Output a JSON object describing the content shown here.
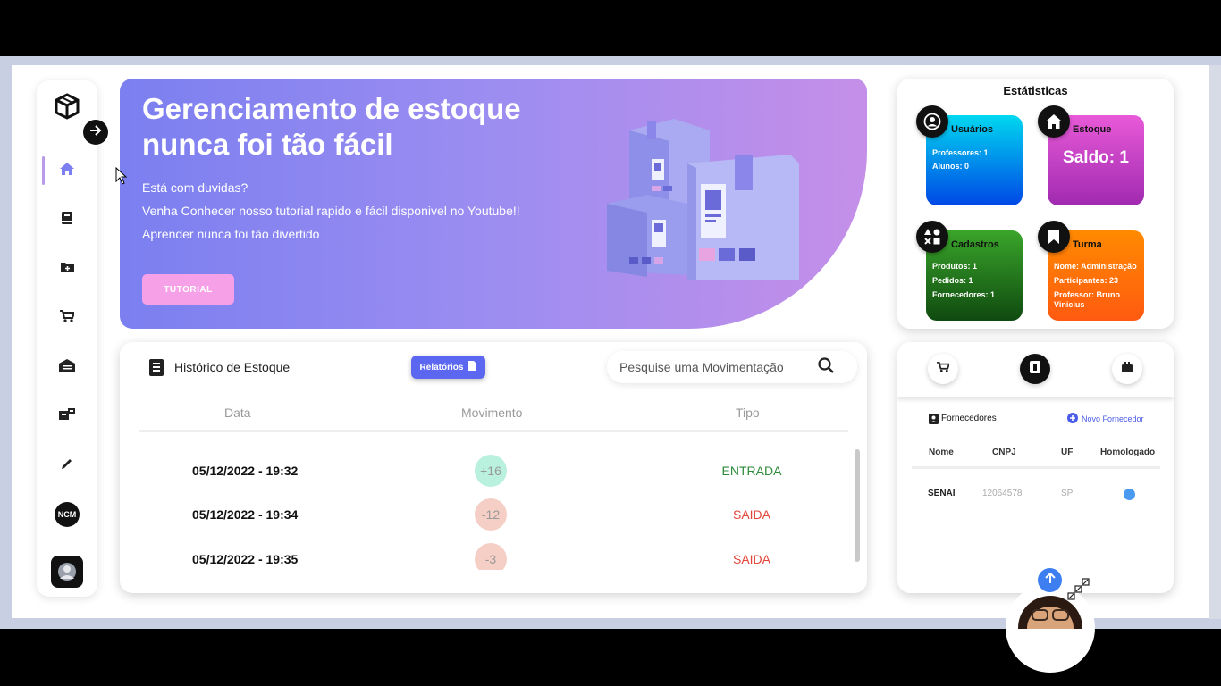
{
  "sidebar": {
    "items": [
      {
        "name": "home-icon",
        "active": true
      },
      {
        "name": "book-icon"
      },
      {
        "name": "folder-add-icon"
      },
      {
        "name": "cart-icon"
      },
      {
        "name": "warehouse-icon"
      },
      {
        "name": "truck-box-icon"
      },
      {
        "name": "pencil-icon"
      }
    ],
    "ncm_label": "NCM"
  },
  "hero": {
    "title_line1": "Gerenciamento de estoque",
    "title_line2": "nunca foi tão fácil",
    "line1": "Está com duvidas?",
    "line2": "Venha Conhecer nosso tutorial rapido e fácil disponivel no Youtube!!",
    "line3": "Aprender nunca foi tão divertido",
    "button_label": "TUTORIAL"
  },
  "history": {
    "title": "Histórico de Estoque",
    "reports_label": "Relatórios",
    "search_placeholder": "Pesquise uma Movimentação",
    "columns": [
      "Data",
      "Movimento",
      "Tipo"
    ],
    "rows": [
      {
        "date": "05/12/2022 - 19:32",
        "movement": "+16",
        "type": "ENTRADA"
      },
      {
        "date": "05/12/2022 - 19:34",
        "movement": "-12",
        "type": "SAIDA"
      },
      {
        "date": "05/12/2022 - 19:35",
        "movement": "-3",
        "type": "SAIDA"
      }
    ]
  },
  "stats": {
    "title": "Estátisticas",
    "usuarios": {
      "title": "Usuários",
      "line1": "Professores: 1",
      "line2": "Alunos: 0"
    },
    "estoque": {
      "title": "Estoque",
      "saldo": "Saldo: 1"
    },
    "cadastros": {
      "title": "Cadastros",
      "line1": "Produtos: 1",
      "line2": "Pedidos: 1",
      "line3": "Fornecedores: 1"
    },
    "turma": {
      "title": "Turma",
      "line1": "Nome: Administração",
      "line2": "Participantes: 23",
      "line3": "Professor: Bruno",
      "line4": "Vinicius"
    }
  },
  "suppliers": {
    "title": "Fornecedores",
    "new_label": "Novo Fornecedor",
    "columns": [
      "Nome",
      "CNPJ",
      "UF",
      "Homologado"
    ],
    "rows": [
      {
        "name": "SENAI",
        "cnpj": "12064578",
        "uf": "SP"
      }
    ]
  },
  "colors": {
    "accent": "#5b67f0",
    "entrada": "#2e8b3a",
    "saida": "#e2453a",
    "usuarios_gradient": [
      "#00d8f0",
      "#0047e6"
    ],
    "estoque_gradient": [
      "#e85ad8",
      "#a02ab0"
    ],
    "cadastros_gradient": [
      "#3aa52a",
      "#0f4a10"
    ],
    "turma_gradient": [
      "#ff7a00",
      "#ff5a10"
    ]
  }
}
